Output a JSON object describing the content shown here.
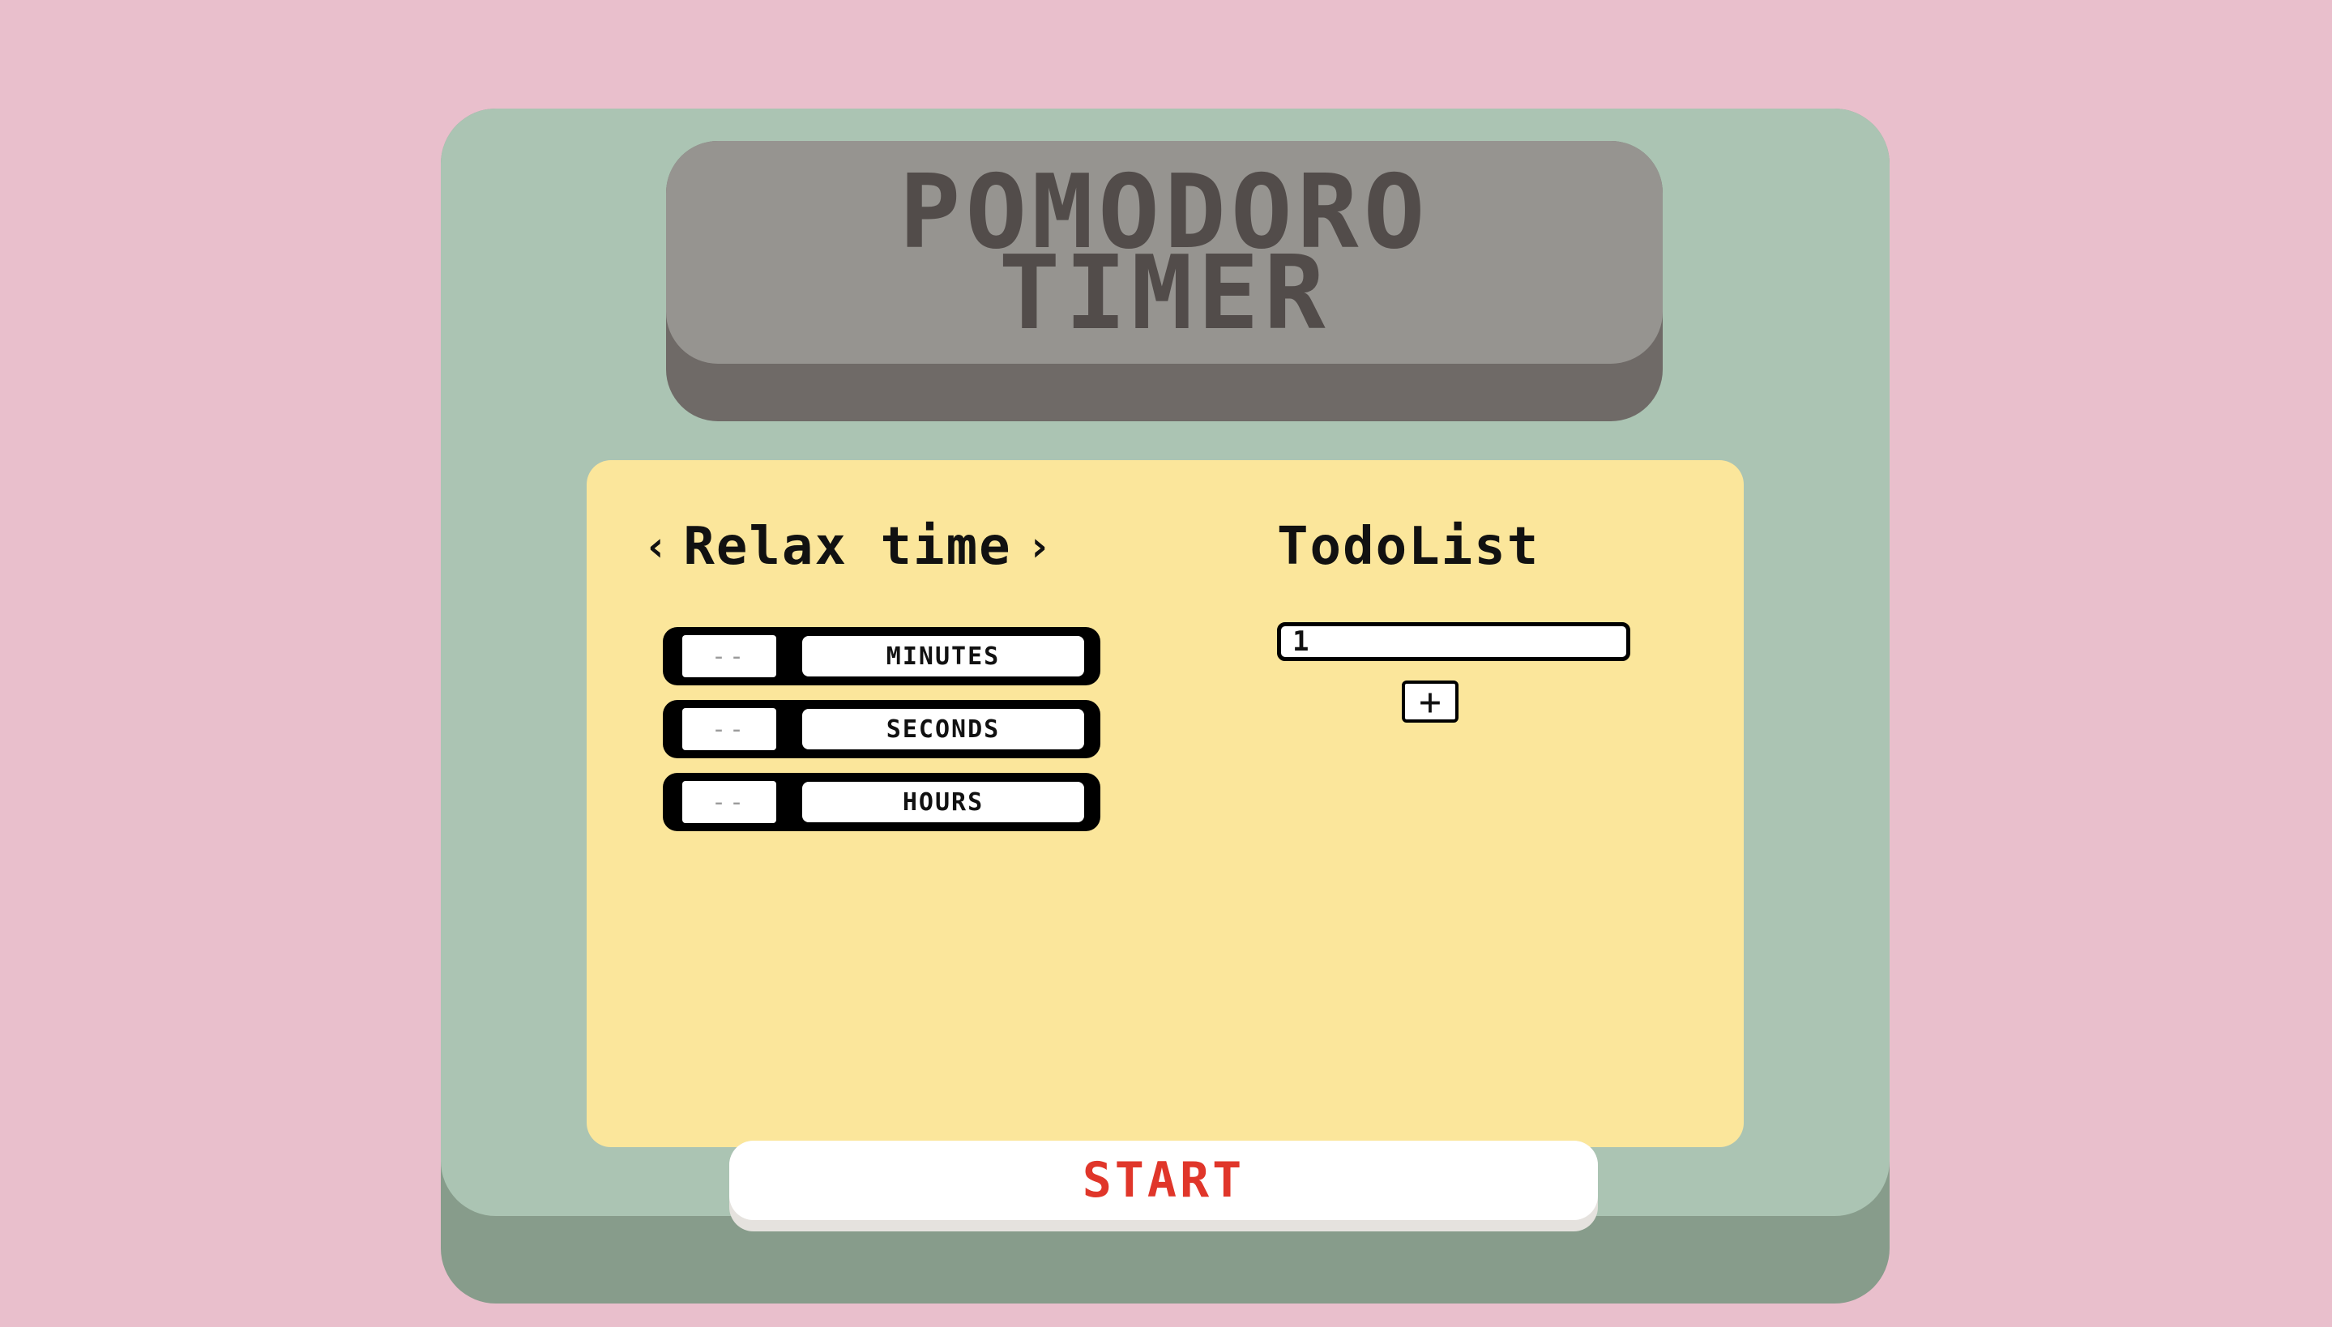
{
  "app": {
    "title": "POMODORO\nTIMER"
  },
  "timer": {
    "mode_label": "Relax time",
    "prev_icon": "chevron-left-icon",
    "next_icon": "chevron-right-icon",
    "prev_glyph": "‹",
    "next_glyph": "›",
    "fields": [
      {
        "unit": "MINUTES",
        "value": "",
        "placeholder": "--"
      },
      {
        "unit": "SECONDS",
        "value": "",
        "placeholder": "--"
      },
      {
        "unit": "HOURS",
        "value": "",
        "placeholder": "--"
      }
    ]
  },
  "todo": {
    "title": "TodoList",
    "input_value": "1",
    "add_icon": "plus-icon",
    "add_glyph": "+"
  },
  "actions": {
    "start_label": "START"
  },
  "colors": {
    "background": "#e9bfcc",
    "device": "#abc4b3",
    "title_plate": "#969490",
    "panel": "#fbe69b",
    "start_text": "#e0362a"
  }
}
